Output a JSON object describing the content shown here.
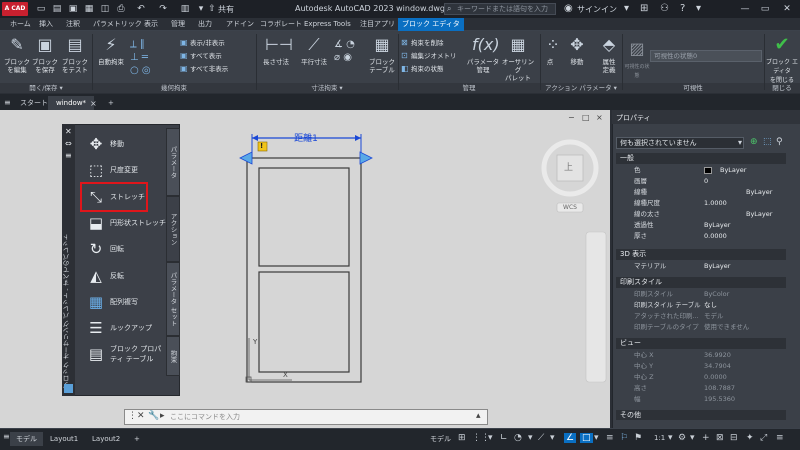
{
  "app": {
    "logo_text": "A CAD",
    "title": "Autodesk AutoCAD 2023   window.dwg",
    "share_label": "共有",
    "search_placeholder": "キーワードまたは語句を入力",
    "signin_label": "サインイン"
  },
  "ribbon_tabs": [
    "ホーム",
    "挿入",
    "注釈",
    "パラメトリック",
    "表示",
    "管理",
    "出力",
    "アドイン",
    "コラボレート",
    "Express Tools",
    "注目アプリ",
    "ブロック エディタ"
  ],
  "ribbon": {
    "open_save": {
      "edit_block": "ブロック\nを編集",
      "save_block": "ブロック\nを保存",
      "test_block": "ブロック\nをテスト"
    },
    "geometric": {
      "auto_constrain": "自動拘束",
      "show_hide": "表示/非表示",
      "show_all": "すべて表示",
      "hide_all": "すべて非表示"
    },
    "dimensional": {
      "linear": "長さ寸法",
      "aligned": "平行寸法",
      "block_table": "ブロック\nテーブル"
    },
    "manage": {
      "erase_attr": "拘束を削除",
      "edit_geometry": "編集ジオメトリ",
      "constraint_status": "拘束の状態",
      "param_manager": "パラメータ\n管理",
      "authoring_palette": "オーサリング\nパレット"
    },
    "action_params": {
      "point": "点",
      "move": "移動",
      "attribute_def": "属性\n定義"
    },
    "visibility": {
      "visibility_mode": "可視性の状態",
      "dropdown_value": "可視性の状態0"
    },
    "close": {
      "close_editor": "ブロック エディタ\nを閉じる"
    },
    "group_labels": [
      "開く/保存 ▾",
      "幾何拘束",
      "寸法拘束 ▾",
      "管理",
      "アクション パラメータ ▾",
      "可視性",
      "閉じる"
    ]
  },
  "doc_tabs": {
    "start": "スタート",
    "window": "window*",
    "add": "+"
  },
  "canvas": {
    "dimension_label": "距離1",
    "viewcube_label": "WCS",
    "viewcube_face": "上",
    "ucs_y": "Y",
    "ucs_x": "X",
    "window_controls": [
      "−",
      "□",
      "×"
    ],
    "grip_warning": "!"
  },
  "palette": {
    "vertical_title": "ブロック オーサリング パレット - すべてのパレット",
    "items": [
      {
        "label": "移動",
        "icon": "move-icon"
      },
      {
        "label": "尺度変更",
        "icon": "scale-icon"
      },
      {
        "label": "ストレッチ",
        "icon": "stretch-icon"
      },
      {
        "label": "円形状ストレッチ",
        "icon": "polar-stretch-icon"
      },
      {
        "label": "回転",
        "icon": "rotate-icon"
      },
      {
        "label": "反転",
        "icon": "flip-icon"
      },
      {
        "label": "配列複写",
        "icon": "array-icon"
      },
      {
        "label": "ルックアップ",
        "icon": "lookup-icon"
      },
      {
        "label": "ブロック プロパティ テーブル",
        "icon": "property-table-icon"
      }
    ],
    "side_tabs": [
      "パラメータ",
      "アクション",
      "パラメータ セット",
      "拘束"
    ]
  },
  "command": {
    "placeholder": "ここにコマンドを入力"
  },
  "properties": {
    "title": "プロパティ",
    "selection": "何も選択されていません",
    "sections": {
      "general": "一般",
      "view3d": "3D 表示",
      "plot_style": "印刷スタイル",
      "view": "ビュー",
      "misc": "その他"
    },
    "general_rows": [
      {
        "k": "色",
        "v": "ByLayer"
      },
      {
        "k": "画層",
        "v": "0"
      },
      {
        "k": "線種",
        "v": "ByLayer"
      },
      {
        "k": "線種尺度",
        "v": "1.0000"
      },
      {
        "k": "線の太さ",
        "v": "ByLayer"
      },
      {
        "k": "透過性",
        "v": "ByLayer"
      },
      {
        "k": "厚さ",
        "v": "0.0000"
      }
    ],
    "view3d_rows": [
      {
        "k": "マテリアル",
        "v": "ByLayer"
      }
    ],
    "plot_rows": [
      {
        "k": "印刷スタイル",
        "v": "ByColor"
      },
      {
        "k": "印刷スタイル テーブル",
        "v": "なし"
      },
      {
        "k": "アタッチされた印刷...",
        "v": "モデル"
      },
      {
        "k": "印刷テーブルのタイプ",
        "v": "使用できません"
      }
    ],
    "view_rows": [
      {
        "k": "中心 X",
        "v": "36.9920"
      },
      {
        "k": "中心 Y",
        "v": "34.7904"
      },
      {
        "k": "中心 Z",
        "v": "0.0000"
      },
      {
        "k": "高さ",
        "v": "108.7887"
      },
      {
        "k": "幅",
        "v": "195.5360"
      }
    ]
  },
  "statusbar": {
    "tabs": [
      "モデル",
      "Layout1",
      "Layout2",
      "+"
    ],
    "model_label": "モデル",
    "scale_label": "1:1"
  }
}
